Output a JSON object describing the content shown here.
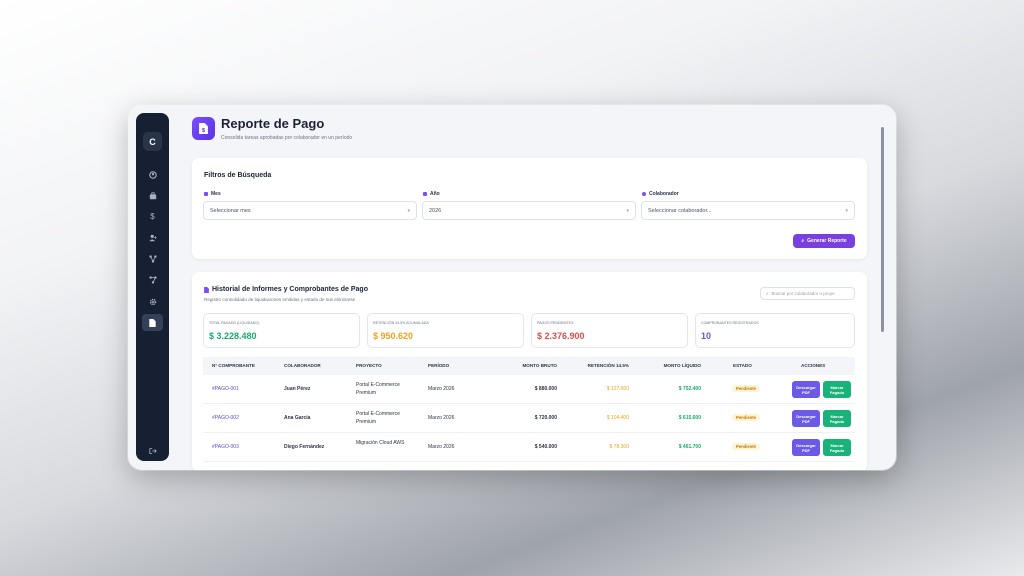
{
  "sidebar": {
    "logo": "C",
    "icons": [
      "dashboard-icon",
      "briefcase-icon",
      "dollar-icon",
      "user-add-icon",
      "network-icon",
      "share-icon",
      "gear-icon",
      "document-icon"
    ],
    "logout_icon": "logout-icon"
  },
  "header": {
    "title": "Reporte de Pago",
    "subtitle": "Consolida tareas aprobadas por colaborador en un período"
  },
  "filters": {
    "title": "Filtros de Búsqueda",
    "month_label": "Mes",
    "month_value": "Seleccionar mes",
    "year_label": "Año",
    "year_value": "2026",
    "collab_label": "Colaborador",
    "collab_value": "Seleccionar colaborador...",
    "generate_button": "Generar Reporte"
  },
  "history": {
    "title": "Historial de Informes y Comprobantes de Pago",
    "subtitle": "Registro consolidado de liquidaciones emitidas y estado de sus eliminarse",
    "search_placeholder": "Buscar por colaborador o proye",
    "stats": [
      {
        "label": "Total pagado (liquidado)",
        "value": "$ 3.228.480",
        "color": "#1aaa6a"
      },
      {
        "label": "Retención 14.5% acumulada",
        "value": "$ 950.620",
        "color": "#f0a21a"
      },
      {
        "label": "Pagos pendientes",
        "value": "$ 2.376.900",
        "color": "#e54b4b"
      },
      {
        "label": "Comprobantes registrados",
        "value": "10",
        "color": "#6a55e6"
      }
    ],
    "columns": [
      "N° Comprobante",
      "Colaborador",
      "Proyecto",
      "Período",
      "Monto Bruto",
      "Retención 14.5%",
      "Monto Líquido",
      "Estado",
      "Acciones"
    ],
    "rows": [
      {
        "id": "#PAGO-001",
        "collab": "Juan Pérez",
        "project": "Portal E-Commerce Premium",
        "period": "Marzo 2026",
        "gross": "$ 880.000",
        "ret": "$ 127.600",
        "net": "$ 752.400",
        "status": "Pendiente",
        "btn1": "Descargar PDF",
        "btn2": "Marcar Pagado"
      },
      {
        "id": "#PAGO-002",
        "collab": "Ana García",
        "project": "Portal E-Commerce Premium",
        "period": "Marzo 2026",
        "gross": "$ 720.000",
        "ret": "$ 104.400",
        "net": "$ 615.600",
        "status": "Pendiente",
        "btn1": "Descargar PDF",
        "btn2": "Marcar Pagado"
      },
      {
        "id": "#PAGO-003",
        "collab": "Diego Fernández",
        "project": "Migración Cloud AWS",
        "period": "Marzo 2026",
        "gross": "$ 540.000",
        "ret": "$ 78.300",
        "net": "$ 461.700",
        "status": "Pendiente",
        "btn1": "Descargar PDF",
        "btn2": "Marcar Pagado"
      }
    ]
  },
  "colors": {
    "accent": "#7a3fe0",
    "sidebar": "#172033",
    "success": "#1aaa6a",
    "warning": "#f0a21a",
    "danger": "#e54b4b",
    "download": "#6a5ae6",
    "paid": "#19b37a"
  }
}
